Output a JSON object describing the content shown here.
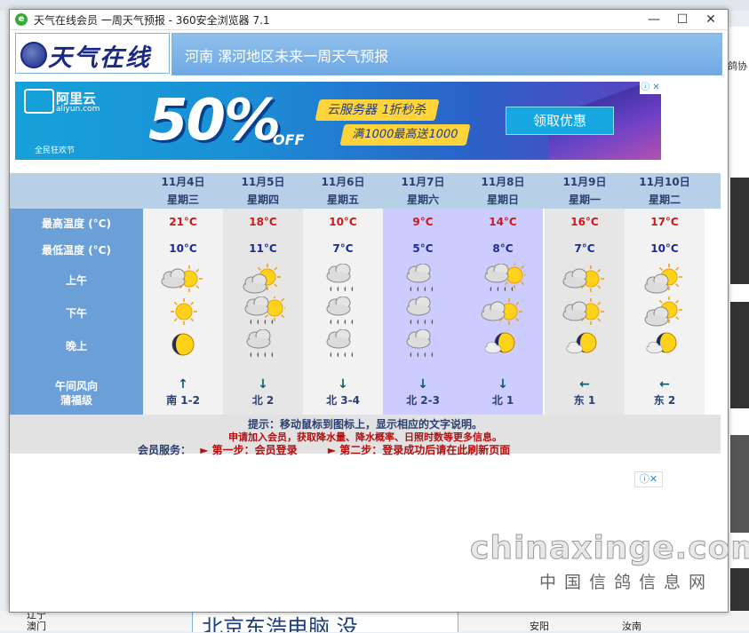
{
  "window": {
    "title": "天气在线会员 一周天气预报 - 360安全浏览器 7.1",
    "min": "—",
    "max": "☐",
    "close": "✕"
  },
  "header": {
    "logo": "天气在线",
    "title": "河南 漯河地区未来一周天气预报"
  },
  "ad": {
    "brand": "阿里云",
    "brand_url": "aliyun.com",
    "festival": "全民狂欢节",
    "discount": "50%",
    "off": "OFF",
    "line1": "云服务器 1折秒杀",
    "line2": "满1000最高送1000",
    "cta": "领取优惠",
    "close_label": "ⓘ ✕"
  },
  "forecast": {
    "row_labels": {
      "high": "最高温度 (°C)",
      "low": "最低温度 (°C)",
      "morning": "上午",
      "afternoon": "下午",
      "night": "晚上",
      "wind": "午间风向",
      "wind_level": "蒲福级"
    },
    "days": [
      {
        "date": "11月4日",
        "weekday": "星期三",
        "high": "21°C",
        "low": "10°C",
        "am": "partly-sunny-cloud",
        "pm": "sunny",
        "night": "moon",
        "arrow": "↑",
        "wind": "南 1-2"
      },
      {
        "date": "11月5日",
        "weekday": "星期四",
        "high": "18°C",
        "low": "11°C",
        "am": "sun-cloud-light",
        "pm": "rain-cloud-sun",
        "night": "rain-cloud",
        "arrow": "↓",
        "wind": "北 2"
      },
      {
        "date": "11月6日",
        "weekday": "星期五",
        "high": "10°C",
        "low": "7°C",
        "am": "rain-cloud",
        "pm": "rain-cloud",
        "night": "rain-cloud",
        "arrow": "↓",
        "wind": "北 3-4"
      },
      {
        "date": "11月7日",
        "weekday": "星期六",
        "high": "9°C",
        "low": "5°C",
        "am": "rain-cloud",
        "pm": "rain-cloud",
        "night": "rain-cloud",
        "arrow": "↓",
        "wind": "北 2-3"
      },
      {
        "date": "11月8日",
        "weekday": "星期日",
        "high": "14°C",
        "low": "8°C",
        "am": "rain-cloud-sun",
        "pm": "partly-sunny-cloud",
        "night": "moon-cloud",
        "arrow": "↓",
        "wind": "北 1"
      },
      {
        "date": "11月9日",
        "weekday": "星期一",
        "high": "16°C",
        "low": "7°C",
        "am": "partly-sunny-cloud",
        "pm": "partly-sunny-cloud",
        "night": "moon-cloud",
        "arrow": "←",
        "wind": "东 1"
      },
      {
        "date": "11月10日",
        "weekday": "星期二",
        "high": "17°C",
        "low": "10°C",
        "am": "sun-cloud-light",
        "pm": "sun-cloud-light",
        "night": "moon-cloud",
        "arrow": "←",
        "wind": "东 2"
      }
    ],
    "hint": "提示：移动鼠标到图标上，显示相应的文字说明。",
    "promo": "申请加入会员，获取降水量、降水概率、日照时数等更多信息。",
    "member_label": "会员服务：",
    "step1": "► 第一步：会员登录",
    "step2": "► 第二步：登录成功后请在此刷新页面"
  },
  "lower_ad": {
    "close_label": "ⓘ✕"
  },
  "watermark": {
    "site": "chinaxinge.com",
    "cn": "中国信鸽信息网"
  },
  "background": {
    "right_text": "鸽协",
    "bottom_left_1": "辽宁",
    "bottom_left_2": "澳门",
    "bottom_ad": "北京东浩电脑 没",
    "bottom_right_1": "安阳",
    "bottom_right_2": "汝南"
  },
  "colors": {
    "high_temp": "#d01818",
    "low_temp": "#1a2a9a",
    "label_column": "#6a9fd8",
    "header_bar": "#7fb3e6",
    "weekend_column": "#ccccff",
    "even_column": "#e6e6e6",
    "odd_column": "#f2f2f2"
  }
}
